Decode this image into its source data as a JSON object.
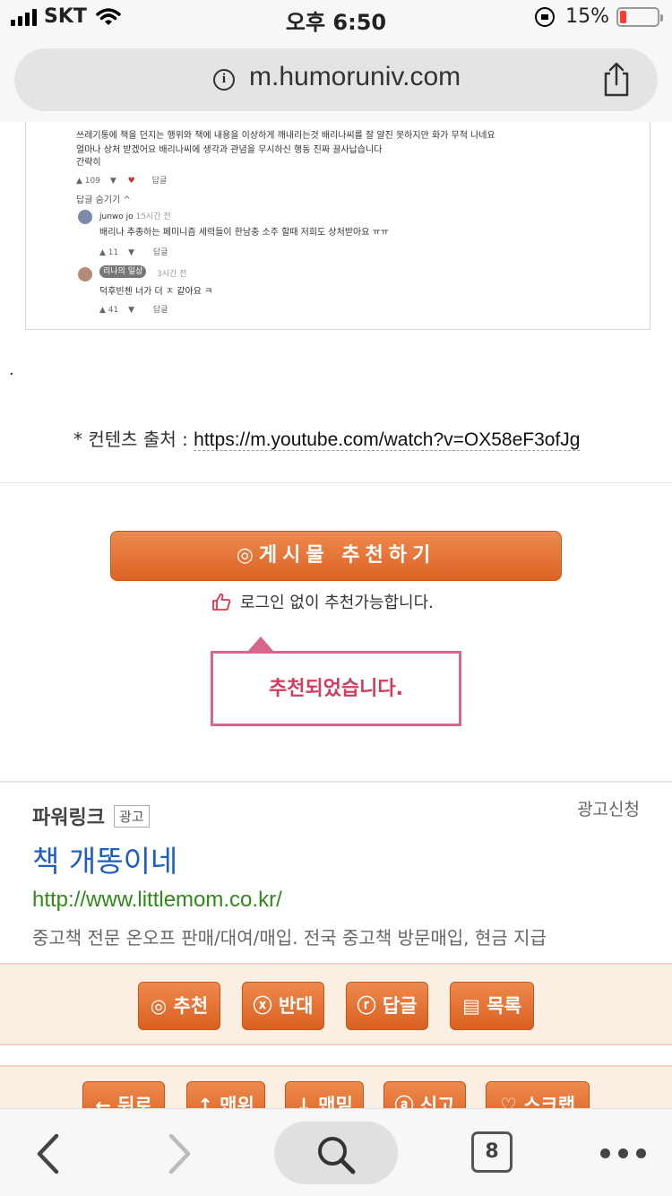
{
  "status_bar": {
    "carrier": "SKT",
    "time": "오후 6:50",
    "battery_percent": "15%",
    "battery_level": 0.15
  },
  "browser": {
    "url": "m.humoruniv.com",
    "tab_count": "8"
  },
  "youtube_comments": {
    "lines": [
      "쓰레기통에 책을 던지는 행위와 책에 내용을 이상하게 깨내리는것 배리나씨를 잘 알진 못하지만 화가 무척 나네요",
      "얼마나 상처 받겠어요 배리나씨에 생각과 관념을 무시하신 행동 진짜 끌사납습니다",
      "간략히"
    ],
    "top_likes": "109",
    "reply_label": "답글",
    "hide_replies": "답글 숨기기",
    "replies": [
      {
        "author": "junwo jo",
        "time": "15시간 전",
        "text": "배리나 추종하는 페미니즘 세력들이 한남충 소주 할때 저희도 상처받아요 ㅠㅠ",
        "likes": "11"
      },
      {
        "author": "리나의 일상",
        "time": "3시간 전",
        "text": "덕후빈첸 너가 더 ㅈ 같아요 ㅋ",
        "likes": "41"
      }
    ]
  },
  "separator_dot": ".",
  "source": {
    "label": "* 컨텐츠 출처 :",
    "link": "https://m.youtube.com/watch?v=OX58eF3ofJg"
  },
  "recommend": {
    "button_label": "◎게시물  추천하기",
    "note": "로그인 없이 추천가능합니다.",
    "toast": "추천되었습니다."
  },
  "ad": {
    "title": "파워링크",
    "badge": "광고",
    "apply": "광고신청",
    "headline": "책 개똥이네",
    "url": "http://www.littlemom.co.kr/",
    "description": "중고책 전문 온오프 판매/대여/매입. 전국 중고책 방문매입, 현금 지급"
  },
  "actions": {
    "recommend": "◎ 추천",
    "oppose": "ⓧ 반대",
    "reply": "ⓡ 답글",
    "list": "▤ 목록"
  },
  "nav": {
    "back": "← 뒤로",
    "top": "↑ 맨위",
    "bottom": "↓ 맨밑",
    "report": "ⓐ 신고",
    "scrap": "♡ 스크랩"
  }
}
